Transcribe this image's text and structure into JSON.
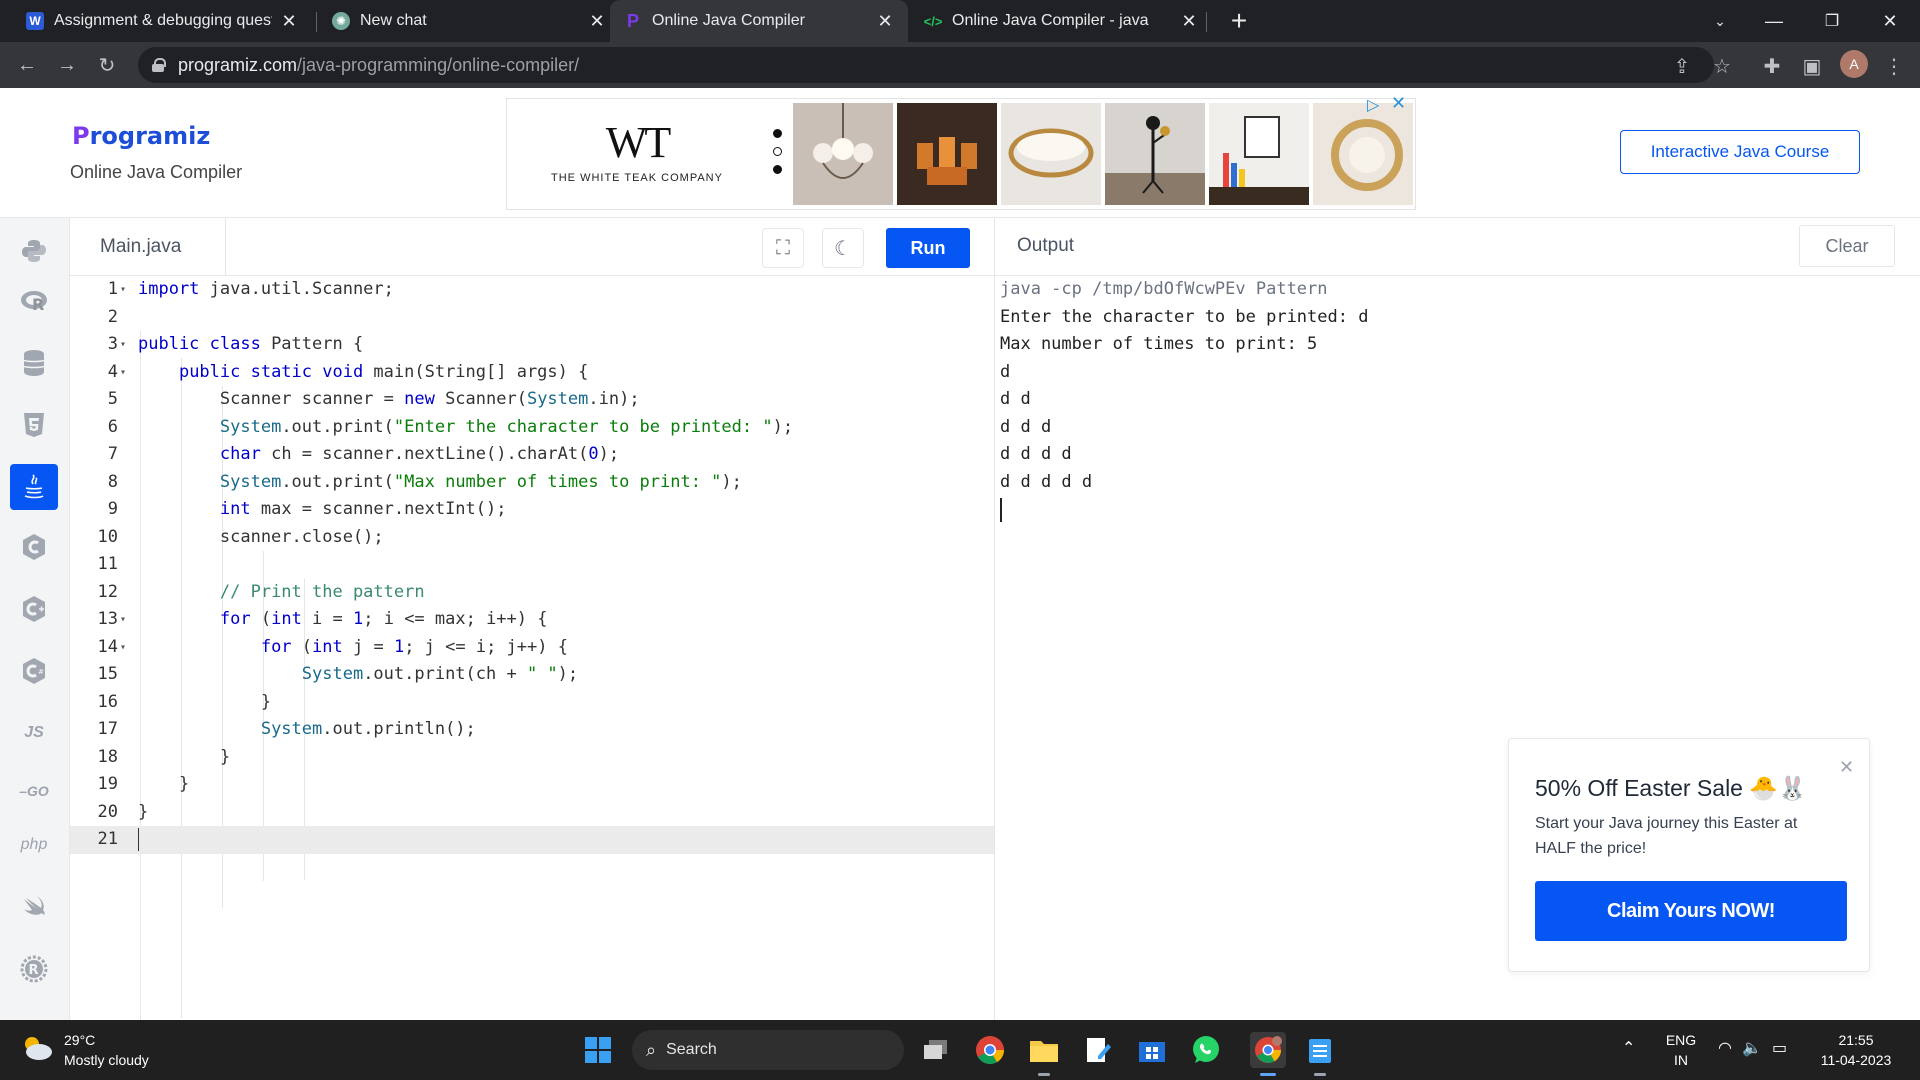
{
  "browser": {
    "tabs": [
      {
        "title": "Assignment & debugging questi",
        "icon": "doc-icon"
      },
      {
        "title": "New chat",
        "icon": "chatgpt-icon"
      },
      {
        "title": "Online Java Compiler",
        "icon": "programiz-icon"
      },
      {
        "title": "Online Java Compiler - java",
        "icon": "code-icon"
      }
    ],
    "url_host": "programiz.com",
    "url_path": "/java-programming/online-compiler/",
    "profile_initial": "A"
  },
  "site": {
    "logo": "rogramiz",
    "logo_p": "P",
    "subtitle": "Online Java Compiler",
    "course_button": "Interactive Java Course",
    "ad": {
      "brand_mark": "WT",
      "brand_name": "THE WHITE TEAK COMPANY"
    }
  },
  "sidebar": {
    "languages": [
      "python",
      "r",
      "sql",
      "html",
      "java",
      "c",
      "cpp",
      "csharp",
      "JS",
      "GO",
      "php",
      "swift",
      "rust"
    ]
  },
  "editor": {
    "file_name": "Main.java",
    "run_label": "Run",
    "lines": [
      "1",
      "2",
      "3",
      "4",
      "5",
      "6",
      "7",
      "8",
      "9",
      "10",
      "11",
      "12",
      "13",
      "14",
      "15",
      "16",
      "17",
      "18",
      "19",
      "20",
      "21"
    ]
  },
  "output": {
    "title": "Output",
    "clear_label": "Clear",
    "lines": [
      "java -cp /tmp/bdOfWcwPEv Pattern",
      "Enter the character to be printed: d",
      "Max number of times to print: 5",
      "d",
      "d d",
      "d d d",
      "d d d d",
      "d d d d d"
    ]
  },
  "promo": {
    "title": "50% Off Easter Sale",
    "text": "Start your Java journey this Easter at HALF the price!",
    "button": "Claim Yours NOW!"
  },
  "taskbar": {
    "temperature": "29°C",
    "condition": "Mostly cloudy",
    "search_label": "Search",
    "lang_top": "ENG",
    "lang_bottom": "IN",
    "time": "21:55",
    "date": "11-04-2023"
  },
  "colors": {
    "accent": "#0556f3",
    "keyword": "#0000cd",
    "string": "#0a7d0a"
  }
}
